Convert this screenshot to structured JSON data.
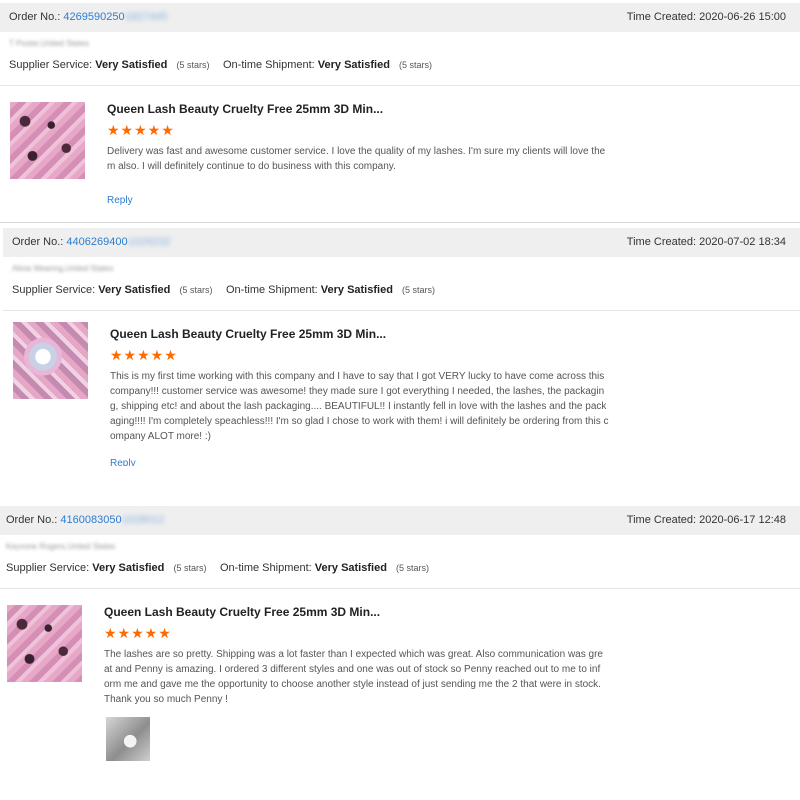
{
  "reviews": [
    {
      "order_label": "Order No.:",
      "order_no": "4269590250",
      "order_blur": "1827445",
      "time": "Time Created: 2020-06-26 15:00",
      "buyer": "T Poster,United States",
      "supplier_label": "Supplier Service:",
      "supplier_value": "Very Satisfied",
      "supplier_stars": "(5 stars)",
      "shipment_label": "On-time Shipment:",
      "shipment_value": "Very Satisfied",
      "shipment_stars": "(5 stars)",
      "product_title": "Queen Lash Beauty Cruelty Free 25mm 3D Min...",
      "rating": "★★★★★",
      "text": "Delivery was fast and awesome customer service. I love the quality of my lashes. I'm sure my clients will love them also. I will definitely continue to do business with this company.",
      "reply": "Reply"
    },
    {
      "order_label": "Order No.:",
      "order_no": "4406269400",
      "order_blur": "1029232",
      "time": "Time Created: 2020-07-02 18:34",
      "buyer": "Alivia Wearing,United States",
      "supplier_label": "Supplier Service:",
      "supplier_value": "Very Satisfied",
      "supplier_stars": "(5 stars)",
      "shipment_label": "On-time Shipment:",
      "shipment_value": "Very Satisfied",
      "shipment_stars": "(5 stars)",
      "product_title": "Queen Lash Beauty Cruelty Free 25mm 3D Min...",
      "rating": "★★★★★",
      "text": "This is my first time working with this company and I have to say that I got VERY lucky to have come across this company!!! customer service was awesome! they made sure I got everything I needed, the lashes, the packaging, shipping etc! and about the lash packaging.... BEAUTIFUL!! I instantly fell in love with the lashes and the packaging!!!! I'm completely speachless!!! I'm so glad I chose to work with them! i will definitely be ordering from this company ALOT more! :)",
      "reply": "Reply"
    },
    {
      "order_label": "Order No.:",
      "order_no": "4160083050",
      "order_blur": "1028012",
      "time": "Time Created: 2020-06-17 12:48",
      "buyer": "Keyvone Rogers,United States",
      "supplier_label": "Supplier Service:",
      "supplier_value": "Very Satisfied",
      "supplier_stars": "(5 stars)",
      "shipment_label": "On-time Shipment:",
      "shipment_value": "Very Satisfied",
      "shipment_stars": "(5 stars)",
      "product_title": "Queen Lash Beauty Cruelty Free 25mm 3D Min...",
      "rating": "★★★★★",
      "text": "The lashes are so pretty. Shipping was a lot faster than I expected which was great. Also communication was great and Penny is amazing. I ordered 3 different styles and one was out of stock so Penny reached out to me to inform me and gave me the opportunity to choose another style instead of just sending me the 2 that were in stock. Thank you so much Penny !"
    }
  ],
  "colors": {
    "star": "#ff6a00",
    "link": "#2d7dd2",
    "header_bg": "#efefef"
  }
}
